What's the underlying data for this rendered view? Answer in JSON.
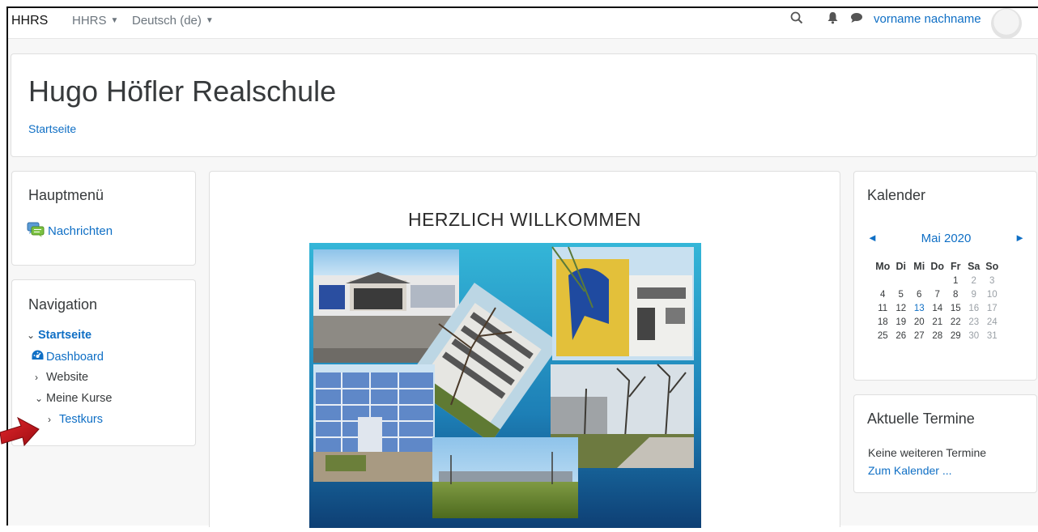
{
  "navbar": {
    "brand": "HHRS",
    "menu_site": "HHRS",
    "menu_lang": "Deutsch (de)",
    "user_name": "vorname nachname",
    "icons": [
      "search-icon",
      "bell-icon",
      "chat-icon",
      "avatar",
      "chevron-down-icon"
    ]
  },
  "header": {
    "title": "Hugo Höfler Realschule",
    "breadcrumb": "Startseite"
  },
  "main_menu": {
    "title": "Hauptmenü",
    "items": [
      {
        "label": "Nachrichten",
        "icon": "forum-icon"
      }
    ]
  },
  "navigation": {
    "title": "Navigation",
    "items": [
      {
        "label": "Startseite",
        "icon": "chevron-down"
      },
      {
        "label": "Dashboard",
        "icon": "dashboard-icon"
      },
      {
        "label": "Website",
        "icon": "chevron-right"
      },
      {
        "label": "Meine Kurse",
        "icon": "chevron-down"
      },
      {
        "label": "Testkurs",
        "icon": "chevron-right"
      }
    ]
  },
  "content": {
    "heading": "HERZLICH WILLKOMMEN",
    "image": "school-photo-collage"
  },
  "calendar": {
    "title": "Kalender",
    "month": "Mai 2020",
    "weekdays": [
      "Mo",
      "Di",
      "Mi",
      "Do",
      "Fr",
      "Sa",
      "So"
    ],
    "weeks": [
      [
        "",
        "",
        "",
        "",
        "1",
        "2",
        "3"
      ],
      [
        "4",
        "5",
        "6",
        "7",
        "8",
        "9",
        "10"
      ],
      [
        "11",
        "12",
        "13",
        "14",
        "15",
        "16",
        "17"
      ],
      [
        "18",
        "19",
        "20",
        "21",
        "22",
        "23",
        "24"
      ],
      [
        "25",
        "26",
        "27",
        "28",
        "29",
        "30",
        "31"
      ]
    ],
    "today": "13"
  },
  "events": {
    "title": "Aktuelle Termine",
    "empty_text": "Keine weiteren Termine",
    "link": "Zum Kalender ..."
  },
  "colors": {
    "link": "#0f6fc5",
    "text": "#373a3c",
    "background": "#f7f7f7",
    "annotation_arrow": "#c0141a"
  }
}
